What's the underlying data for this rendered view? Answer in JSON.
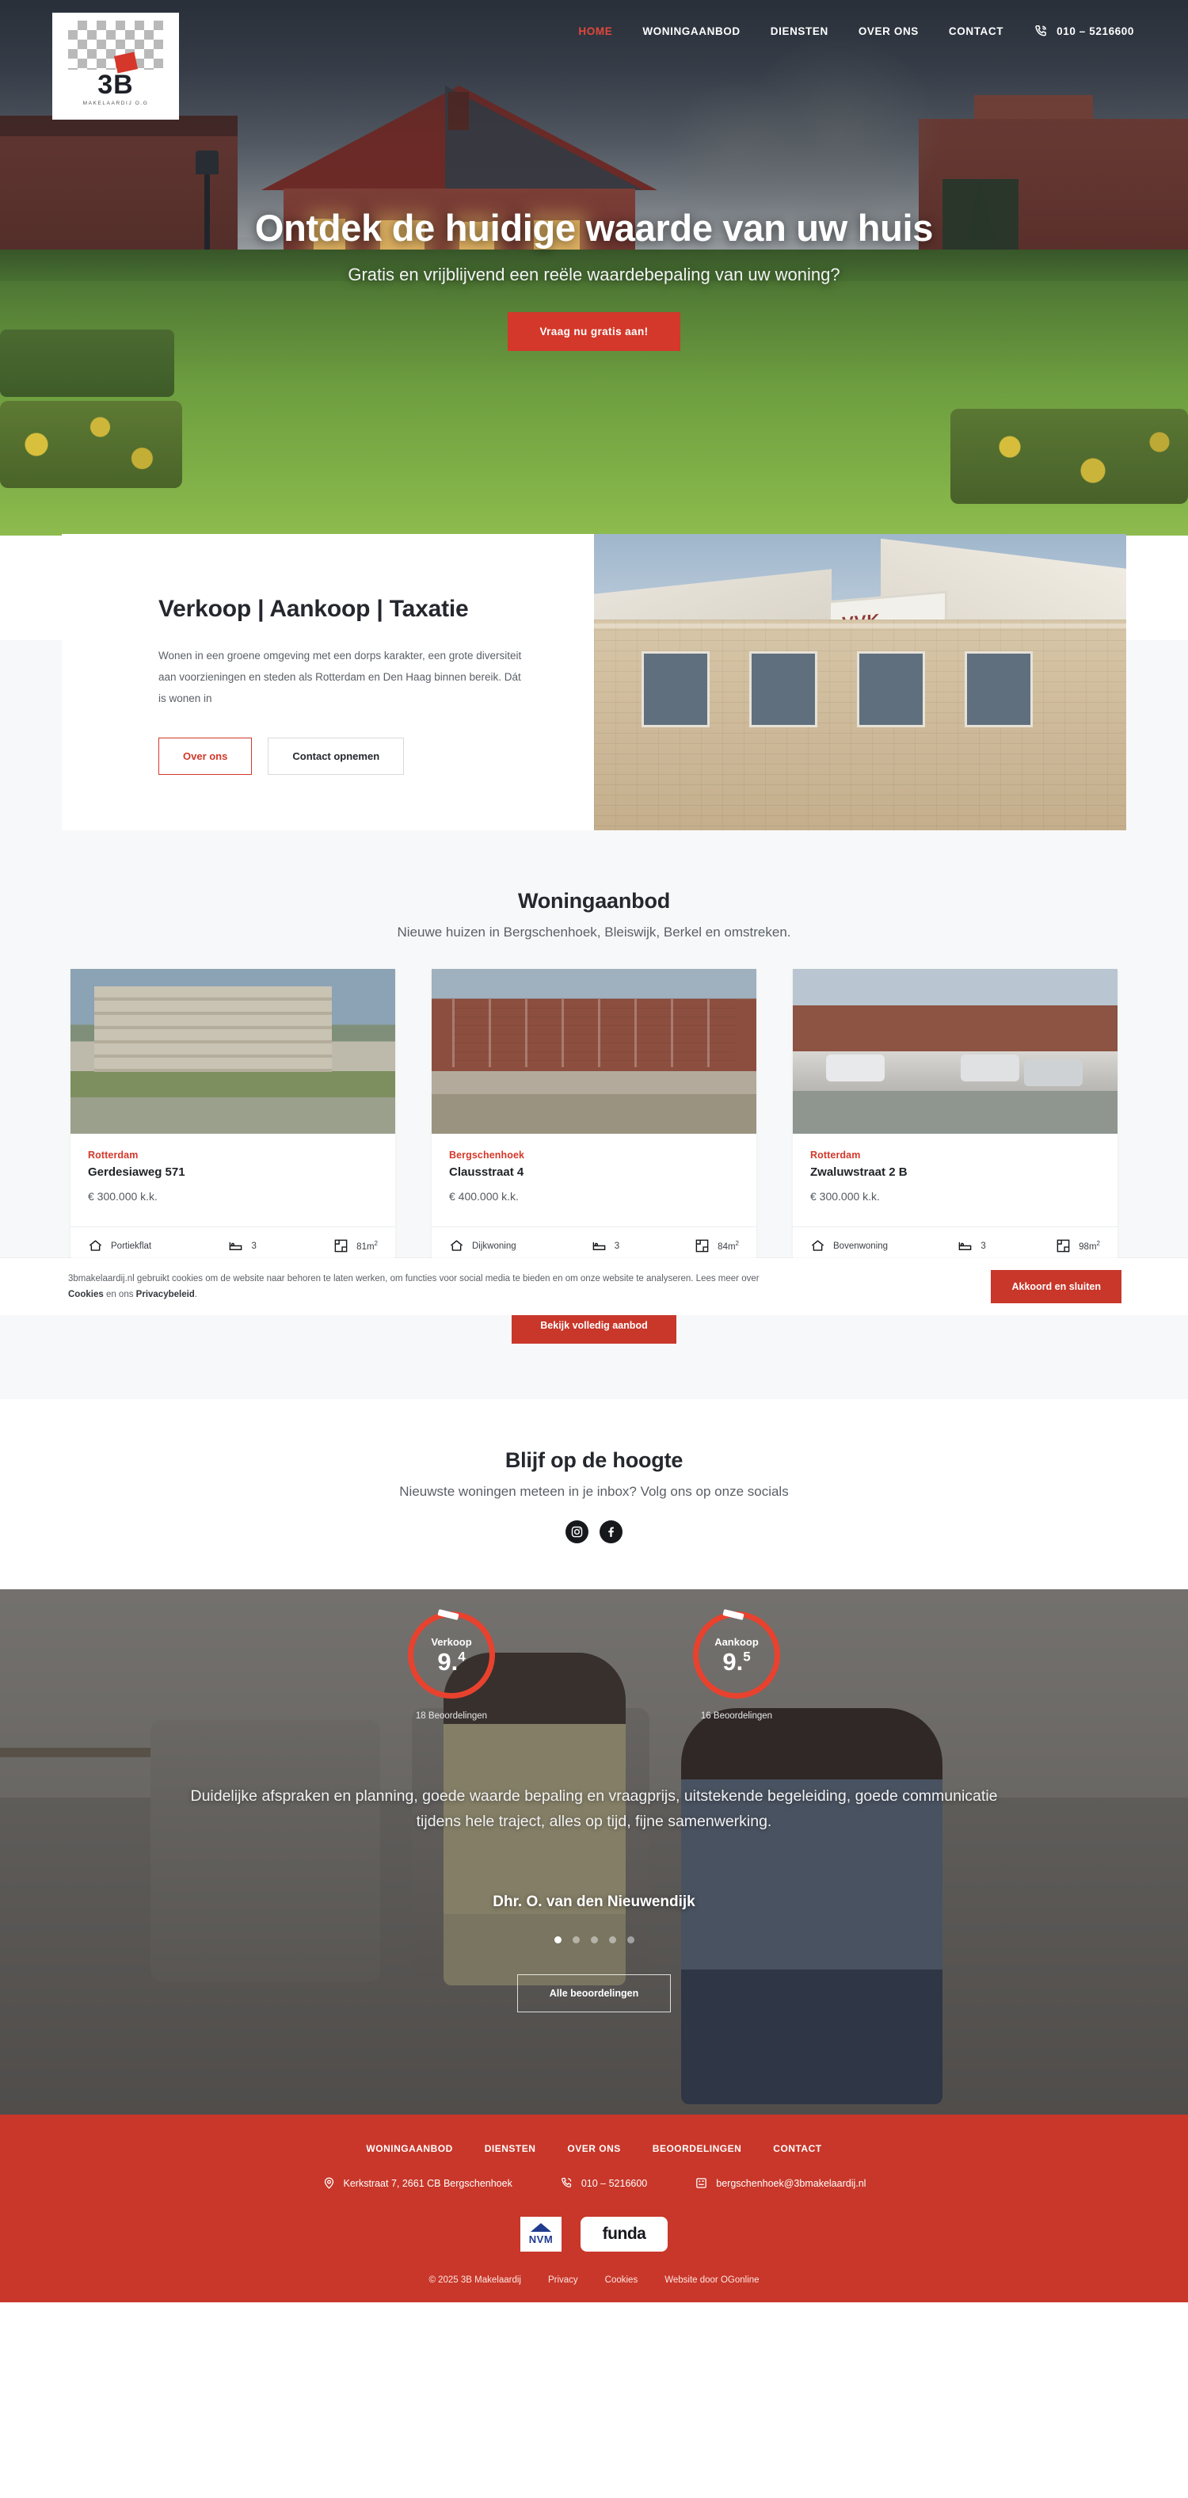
{
  "nav": {
    "logo": {
      "brand": "3B",
      "sub": "MAKELAARDIJ O.G"
    },
    "items": [
      {
        "label": "HOME",
        "active": true
      },
      {
        "label": "WONINGAANBOD",
        "active": false
      },
      {
        "label": "DIENSTEN",
        "active": false
      },
      {
        "label": "OVER ONS",
        "active": false
      },
      {
        "label": "CONTACT",
        "active": false
      }
    ],
    "phone": "010 – 5216600"
  },
  "hero": {
    "title": "Ontdek de huidige waarde van uw huis",
    "subtitle": "Gratis en vrijblijvend een reële waardebepaling van uw woning?",
    "cta": "Vraag nu gratis aan!"
  },
  "intro": {
    "heading": "Verkoop | Aankoop | Taxatie",
    "paragraph": "Wonen in een groene omgeving met een dorps karakter, een grote diversiteit aan voorzieningen en steden als Rotterdam en Den Haag binnen bereik. Dát is wonen in",
    "btn_primary": "Over ons",
    "btn_secondary": "Contact opnemen",
    "sign_text": "VVK"
  },
  "cookie": {
    "text_part1": "3bmakelaardij.nl gebruikt cookies om de website naar behoren te laten werken, om functies voor social media te bieden en om onze website te analyseren. Lees meer over ",
    "link1": "Cookies",
    "text_part2": " en ons ",
    "link2": "Privacybeleid",
    "text_part3": ".",
    "button": "Akkoord en sluiten"
  },
  "listings": {
    "title": "Woningaanbod",
    "subtitle": "Nieuwe huizen in Bergschenhoek, Bleiswijk, Berkel en omstreken.",
    "cta": "Bekijk volledig aanbod",
    "cards": [
      {
        "city": "Rotterdam",
        "street": "Gerdesiaweg 571",
        "price": "€ 300.000 k.k.",
        "type": "Portiekflat",
        "bedrooms": "3",
        "area": "81m",
        "area_unit": "2"
      },
      {
        "city": "Bergschenhoek",
        "street": "Clausstraat 4",
        "price": "€ 400.000 k.k.",
        "type": "Dijkwoning",
        "bedrooms": "3",
        "area": "84m",
        "area_unit": "2"
      },
      {
        "city": "Rotterdam",
        "street": "Zwaluwstraat 2 B",
        "price": "€ 300.000 k.k.",
        "type": "Bovenwoning",
        "bedrooms": "3",
        "area": "98m",
        "area_unit": "2"
      }
    ]
  },
  "socials": {
    "title": "Blijf op de hoogte",
    "subtitle": "Nieuwste woningen meteen in je inbox? Volg ons op onze socials",
    "icons": [
      "instagram-icon",
      "facebook-icon"
    ]
  },
  "reviews": {
    "scores": [
      {
        "label": "Verkoop",
        "whole": "9.",
        "decimal": "4",
        "count": "18 Beoordelingen"
      },
      {
        "label": "Aankoop",
        "whole": "9.",
        "decimal": "5",
        "count": "16 Beoordelingen"
      }
    ],
    "quote": "Duidelijke afspraken en planning, goede waarde bepaling en vraagprijs, uitstekende begeleiding, goede communicatie tijdens hele traject, alles op tijd, fijne samenwerking.",
    "author": "Dhr. O. van den Nieuwendijk",
    "dots": 5,
    "active_dot": 0,
    "cta": "Alle beoordelingen"
  },
  "footer": {
    "nav": [
      "WONINGAANBOD",
      "DIENSTEN",
      "OVER ONS",
      "BEOORDELINGEN",
      "CONTACT"
    ],
    "address": "Kerkstraat 7, 2661 CB Bergschenhoek",
    "phone": "010 – 5216600",
    "email": "bergschenhoek@3bmakelaardij.nl",
    "logo_nvm": "NVM",
    "logo_funda": "funda",
    "copyright": "© 2025 3B Makelaardij",
    "legal": [
      "Privacy",
      "Cookies",
      "Website door OGonline"
    ]
  },
  "colors": {
    "brand_red": "#c8372a",
    "accent_red": "#d3382a",
    "dark": "#24272d",
    "light_bg": "#f7f8f9"
  }
}
